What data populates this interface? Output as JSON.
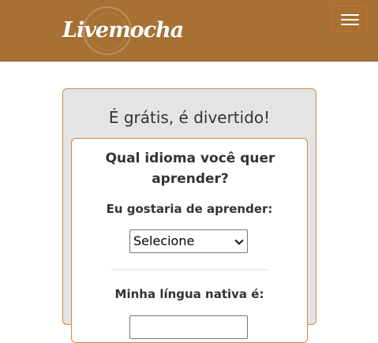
{
  "header": {
    "logo_text": "Livemocha",
    "logo_stamp_text": "LIVEMOCHA",
    "menu_icon": "hamburger-icon",
    "brand_color": "#a67133"
  },
  "signup": {
    "tagline": "É grátis, é divertido!",
    "question": "Qual idioma você quer aprender?",
    "learn_label": "Eu gostaria de aprender:",
    "learn_select_value": "Selecione",
    "native_label": "Minha língua nativa é:"
  }
}
